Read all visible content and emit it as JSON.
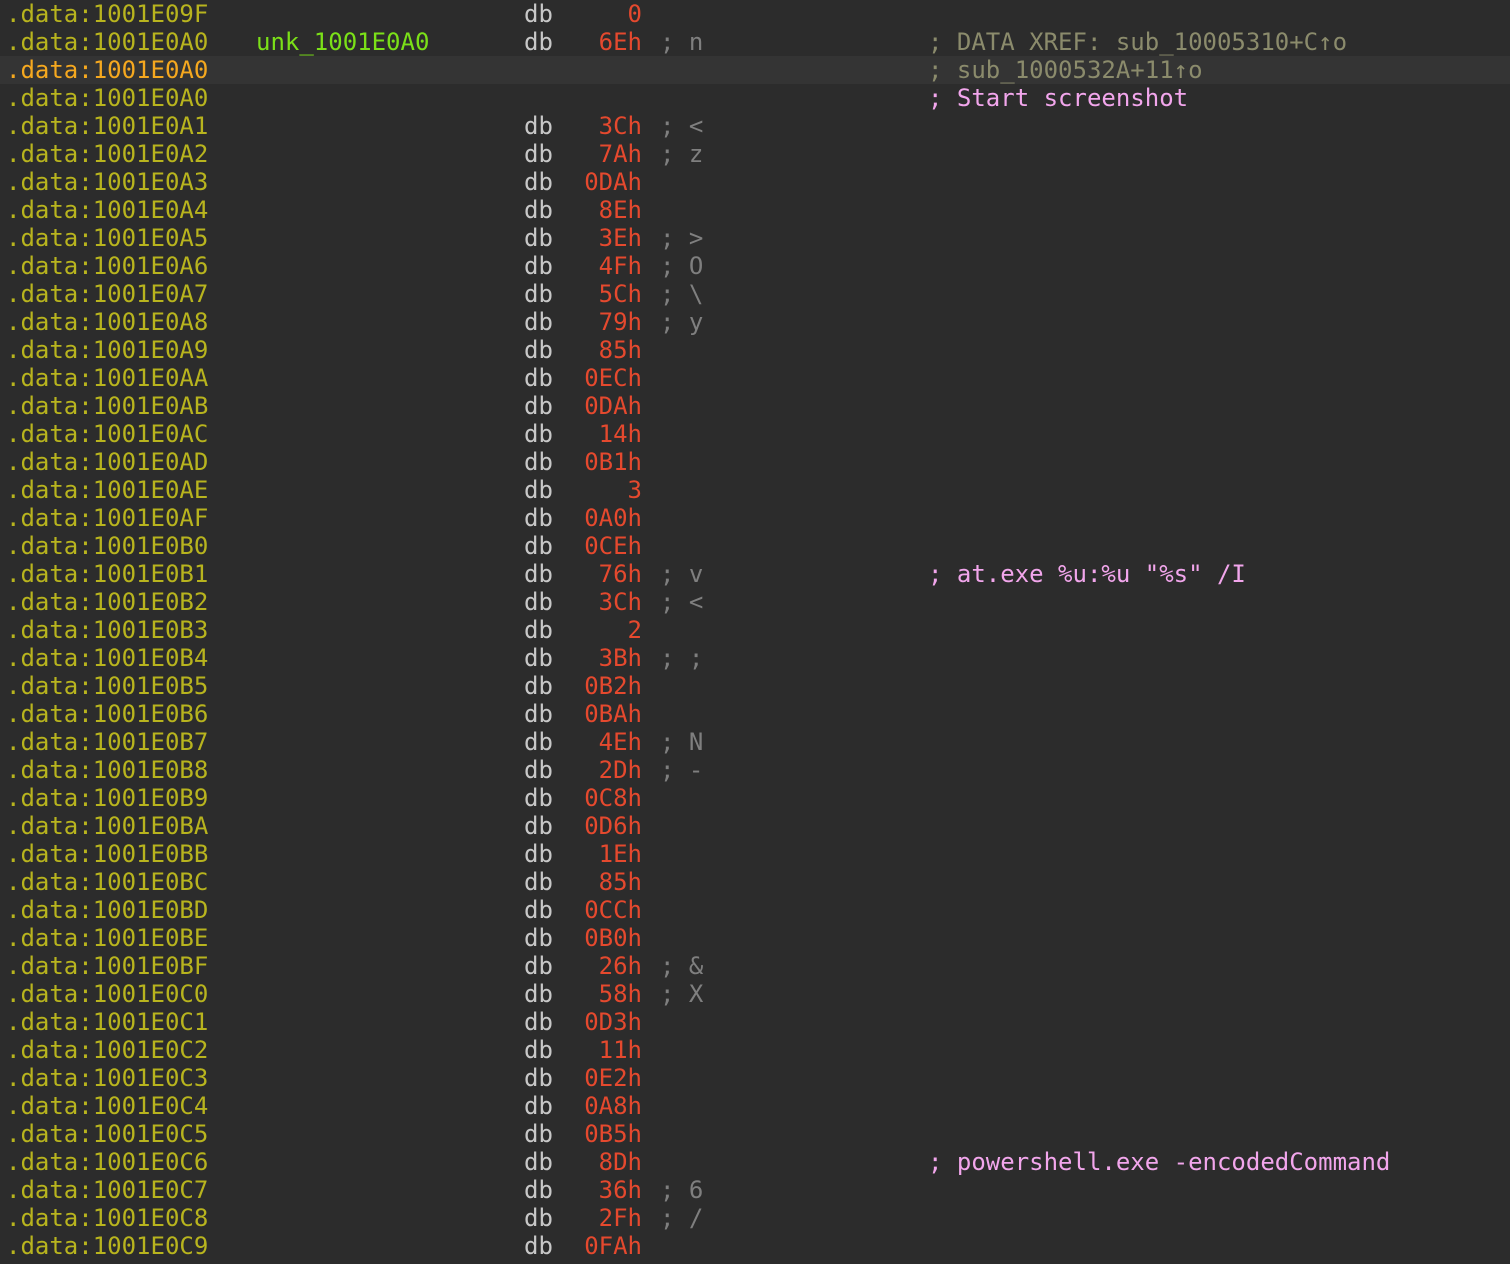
{
  "window": {
    "title": ""
  },
  "listing": {
    "rows": [
      {
        "addr": ".data:1001E09F",
        "label": "",
        "mnemonic": "db",
        "value": "0",
        "char": "",
        "comment": "",
        "comment_kind": ""
      },
      {
        "addr": ".data:1001E0A0",
        "label": "unk_1001E0A0",
        "mnemonic": "db",
        "value": "6Eh",
        "char": "; n",
        "comment": "; DATA XREF: sub_10005310+C↑o",
        "comment_kind": "xref"
      },
      {
        "addr": ".data:1001E0A0",
        "label": "",
        "mnemonic": "",
        "value": "",
        "char": "",
        "comment": "; sub_1000532A+11↑o",
        "comment_kind": "xref",
        "current": true
      },
      {
        "addr": ".data:1001E0A0",
        "label": "",
        "mnemonic": "",
        "value": "",
        "char": "",
        "comment": "; Start screenshot",
        "comment_kind": "str"
      },
      {
        "addr": ".data:1001E0A1",
        "label": "",
        "mnemonic": "db",
        "value": "3Ch",
        "char": "; <",
        "comment": "",
        "comment_kind": ""
      },
      {
        "addr": ".data:1001E0A2",
        "label": "",
        "mnemonic": "db",
        "value": "7Ah",
        "char": "; z",
        "comment": "",
        "comment_kind": ""
      },
      {
        "addr": ".data:1001E0A3",
        "label": "",
        "mnemonic": "db",
        "value": "0DAh",
        "char": "",
        "comment": "",
        "comment_kind": ""
      },
      {
        "addr": ".data:1001E0A4",
        "label": "",
        "mnemonic": "db",
        "value": "8Eh",
        "char": "",
        "comment": "",
        "comment_kind": ""
      },
      {
        "addr": ".data:1001E0A5",
        "label": "",
        "mnemonic": "db",
        "value": "3Eh",
        "char": "; >",
        "comment": "",
        "comment_kind": ""
      },
      {
        "addr": ".data:1001E0A6",
        "label": "",
        "mnemonic": "db",
        "value": "4Fh",
        "char": "; O",
        "comment": "",
        "comment_kind": ""
      },
      {
        "addr": ".data:1001E0A7",
        "label": "",
        "mnemonic": "db",
        "value": "5Ch",
        "char": "; \\",
        "comment": "",
        "comment_kind": ""
      },
      {
        "addr": ".data:1001E0A8",
        "label": "",
        "mnemonic": "db",
        "value": "79h",
        "char": "; y",
        "comment": "",
        "comment_kind": ""
      },
      {
        "addr": ".data:1001E0A9",
        "label": "",
        "mnemonic": "db",
        "value": "85h",
        "char": "",
        "comment": "",
        "comment_kind": ""
      },
      {
        "addr": ".data:1001E0AA",
        "label": "",
        "mnemonic": "db",
        "value": "0ECh",
        "char": "",
        "comment": "",
        "comment_kind": ""
      },
      {
        "addr": ".data:1001E0AB",
        "label": "",
        "mnemonic": "db",
        "value": "0DAh",
        "char": "",
        "comment": "",
        "comment_kind": ""
      },
      {
        "addr": ".data:1001E0AC",
        "label": "",
        "mnemonic": "db",
        "value": "14h",
        "char": "",
        "comment": "",
        "comment_kind": ""
      },
      {
        "addr": ".data:1001E0AD",
        "label": "",
        "mnemonic": "db",
        "value": "0B1h",
        "char": "",
        "comment": "",
        "comment_kind": ""
      },
      {
        "addr": ".data:1001E0AE",
        "label": "",
        "mnemonic": "db",
        "value": "3",
        "char": "",
        "comment": "",
        "comment_kind": ""
      },
      {
        "addr": ".data:1001E0AF",
        "label": "",
        "mnemonic": "db",
        "value": "0A0h",
        "char": "",
        "comment": "",
        "comment_kind": ""
      },
      {
        "addr": ".data:1001E0B0",
        "label": "",
        "mnemonic": "db",
        "value": "0CEh",
        "char": "",
        "comment": "",
        "comment_kind": ""
      },
      {
        "addr": ".data:1001E0B1",
        "label": "",
        "mnemonic": "db",
        "value": "76h",
        "char": "; v",
        "comment": "; at.exe %u:%u \"%s\" /I",
        "comment_kind": "str"
      },
      {
        "addr": ".data:1001E0B2",
        "label": "",
        "mnemonic": "db",
        "value": "3Ch",
        "char": "; <",
        "comment": "",
        "comment_kind": ""
      },
      {
        "addr": ".data:1001E0B3",
        "label": "",
        "mnemonic": "db",
        "value": "2",
        "char": "",
        "comment": "",
        "comment_kind": ""
      },
      {
        "addr": ".data:1001E0B4",
        "label": "",
        "mnemonic": "db",
        "value": "3Bh",
        "char": "; ;",
        "comment": "",
        "comment_kind": ""
      },
      {
        "addr": ".data:1001E0B5",
        "label": "",
        "mnemonic": "db",
        "value": "0B2h",
        "char": "",
        "comment": "",
        "comment_kind": ""
      },
      {
        "addr": ".data:1001E0B6",
        "label": "",
        "mnemonic": "db",
        "value": "0BAh",
        "char": "",
        "comment": "",
        "comment_kind": ""
      },
      {
        "addr": ".data:1001E0B7",
        "label": "",
        "mnemonic": "db",
        "value": "4Eh",
        "char": "; N",
        "comment": "",
        "comment_kind": ""
      },
      {
        "addr": ".data:1001E0B8",
        "label": "",
        "mnemonic": "db",
        "value": "2Dh",
        "char": "; -",
        "comment": "",
        "comment_kind": ""
      },
      {
        "addr": ".data:1001E0B9",
        "label": "",
        "mnemonic": "db",
        "value": "0C8h",
        "char": "",
        "comment": "",
        "comment_kind": ""
      },
      {
        "addr": ".data:1001E0BA",
        "label": "",
        "mnemonic": "db",
        "value": "0D6h",
        "char": "",
        "comment": "",
        "comment_kind": ""
      },
      {
        "addr": ".data:1001E0BB",
        "label": "",
        "mnemonic": "db",
        "value": "1Eh",
        "char": "",
        "comment": "",
        "comment_kind": ""
      },
      {
        "addr": ".data:1001E0BC",
        "label": "",
        "mnemonic": "db",
        "value": "85h",
        "char": "",
        "comment": "",
        "comment_kind": ""
      },
      {
        "addr": ".data:1001E0BD",
        "label": "",
        "mnemonic": "db",
        "value": "0CCh",
        "char": "",
        "comment": "",
        "comment_kind": ""
      },
      {
        "addr": ".data:1001E0BE",
        "label": "",
        "mnemonic": "db",
        "value": "0B0h",
        "char": "",
        "comment": "",
        "comment_kind": ""
      },
      {
        "addr": ".data:1001E0BF",
        "label": "",
        "mnemonic": "db",
        "value": "26h",
        "char": "; &",
        "comment": "",
        "comment_kind": ""
      },
      {
        "addr": ".data:1001E0C0",
        "label": "",
        "mnemonic": "db",
        "value": "58h",
        "char": "; X",
        "comment": "",
        "comment_kind": ""
      },
      {
        "addr": ".data:1001E0C1",
        "label": "",
        "mnemonic": "db",
        "value": "0D3h",
        "char": "",
        "comment": "",
        "comment_kind": ""
      },
      {
        "addr": ".data:1001E0C2",
        "label": "",
        "mnemonic": "db",
        "value": "11h",
        "char": "",
        "comment": "",
        "comment_kind": ""
      },
      {
        "addr": ".data:1001E0C3",
        "label": "",
        "mnemonic": "db",
        "value": "0E2h",
        "char": "",
        "comment": "",
        "comment_kind": ""
      },
      {
        "addr": ".data:1001E0C4",
        "label": "",
        "mnemonic": "db",
        "value": "0A8h",
        "char": "",
        "comment": "",
        "comment_kind": ""
      },
      {
        "addr": ".data:1001E0C5",
        "label": "",
        "mnemonic": "db",
        "value": "0B5h",
        "char": "",
        "comment": "",
        "comment_kind": ""
      },
      {
        "addr": ".data:1001E0C6",
        "label": "",
        "mnemonic": "db",
        "value": "8Dh",
        "char": "",
        "comment": "; powershell.exe -encodedCommand",
        "comment_kind": "str"
      },
      {
        "addr": ".data:1001E0C7",
        "label": "",
        "mnemonic": "db",
        "value": "36h",
        "char": "; 6",
        "comment": "",
        "comment_kind": ""
      },
      {
        "addr": ".data:1001E0C8",
        "label": "",
        "mnemonic": "db",
        "value": "2Fh",
        "char": "; /",
        "comment": "",
        "comment_kind": ""
      },
      {
        "addr": ".data:1001E0C9",
        "label": "",
        "mnemonic": "db",
        "value": "0FAh",
        "char": "",
        "comment": "",
        "comment_kind": ""
      }
    ]
  }
}
